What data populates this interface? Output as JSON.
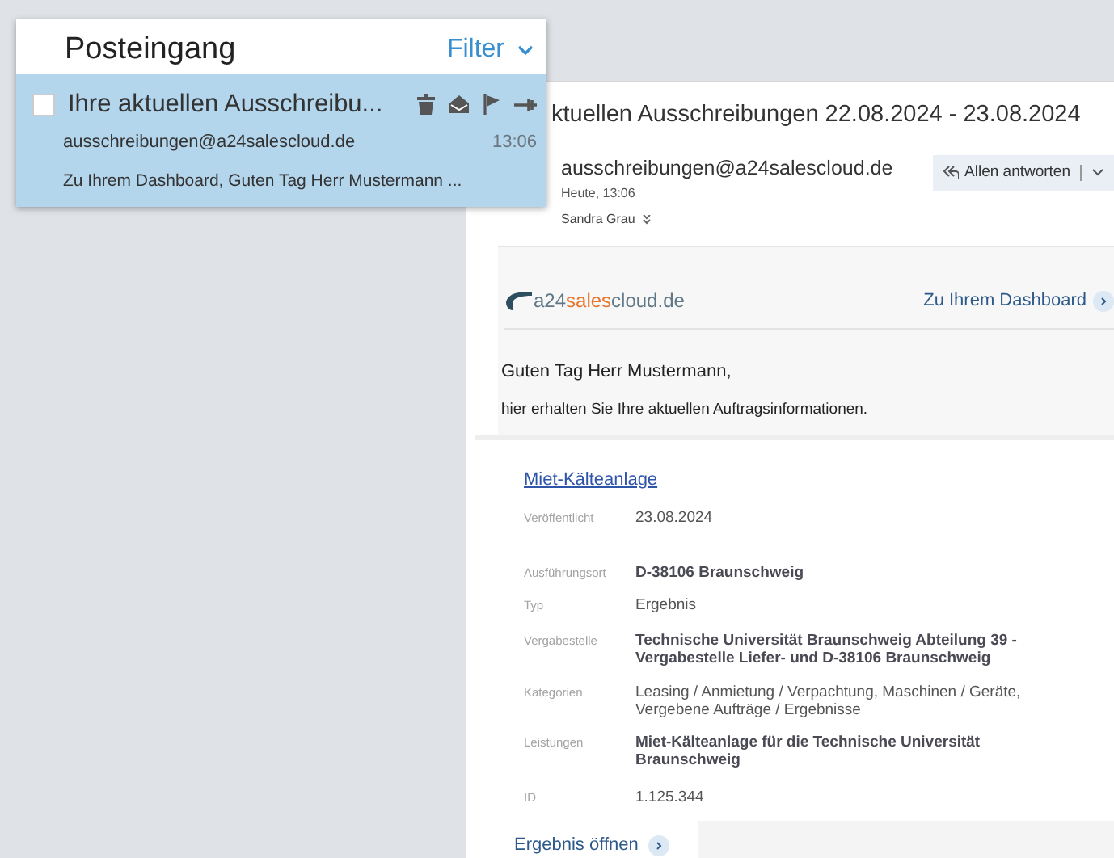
{
  "inbox": {
    "title": "Posteingang",
    "filter": "Filter"
  },
  "messages": [
    {
      "subject": "Ihre aktuellen Ausschreibu...",
      "sender": "ausschreibungen@a24salescloud.de",
      "time": "13:06",
      "preview": "Zu Ihrem Dashboard, Guten Tag Herr Mustermann ...",
      "selected": true,
      "checked": false
    }
  ],
  "reading_pane": {
    "subject": "ktuellen Ausschreibungen 22.08.2024 - 23.08.2024",
    "sender": "ausschreibungen@a24salescloud.de",
    "date": "Heute, 13:06",
    "recipient": "Sandra Grau",
    "reply_button": "Allen antworten"
  },
  "email_body": {
    "logo": [
      "a24",
      "sales",
      "cloud.de"
    ],
    "dashboard_link": "Zu Ihrem Dashboard",
    "greeting": "Guten Tag Herr Mustermann,",
    "intro": "hier erhalten Sie Ihre aktuellen Auftragsinformationen.",
    "tender": {
      "title": "Miet-Kälteanlage",
      "fields": [
        {
          "label": "Veröffentlicht",
          "value": "23.08.2024",
          "bold": false
        },
        {
          "label": "Ausführungsort",
          "value": "D-38106 Braunschweig",
          "bold": true
        },
        {
          "label": "Typ",
          "value": "Ergebnis",
          "bold": false
        },
        {
          "label": "Vergabestelle",
          "value": "Technische Universität Braunschweig Abteilung 39 - Vergabestelle Liefer- und D-38106 Braunschweig",
          "bold": true
        },
        {
          "label": "Kategorien",
          "value": "Leasing / Anmietung / Verpachtung, Maschinen / Geräte, Vergebene Aufträge / Ergebnisse",
          "bold": false
        },
        {
          "label": "Leistungen",
          "value": "Miet-Kälteanlage für die Technische Universität Braunschweig",
          "bold": true
        },
        {
          "label": "ID",
          "value": "1.125.344",
          "bold": false
        }
      ],
      "open_button": "Ergebnis öffnen"
    }
  }
}
